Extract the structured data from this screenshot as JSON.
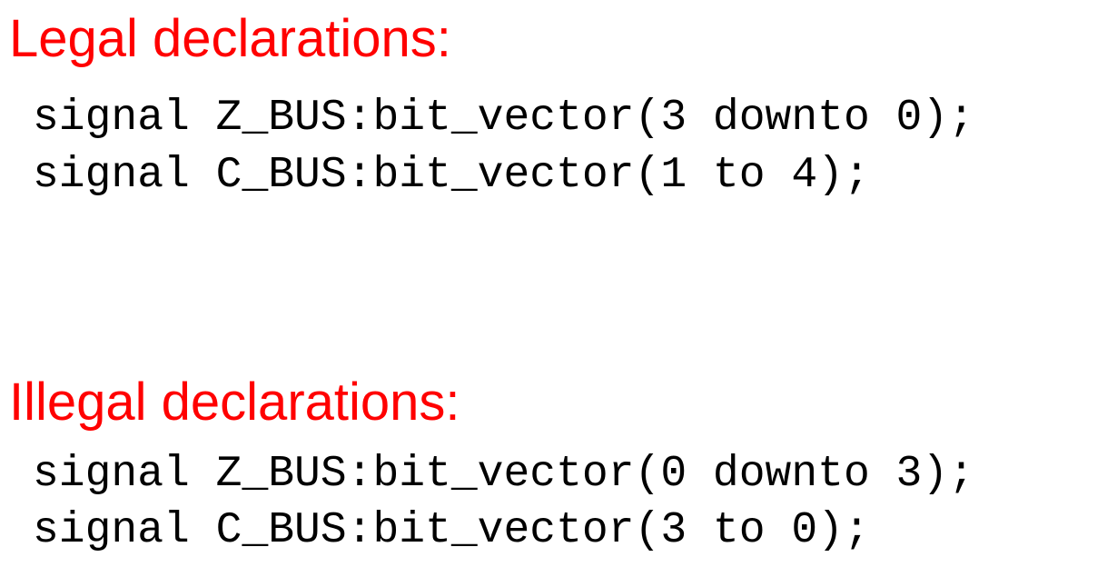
{
  "legal": {
    "heading": "Legal declarations:",
    "lines": [
      "signal Z_BUS:bit_vector(3 downto 0);",
      "signal C_BUS:bit_vector(1 to 4);"
    ]
  },
  "illegal": {
    "heading": "Illegal declarations:",
    "lines": [
      "signal Z_BUS:bit_vector(0 downto 3);",
      "signal C_BUS:bit_vector(3 to 0);"
    ]
  },
  "colors": {
    "heading": "#ff0000",
    "code": "#000000",
    "background": "#ffffff"
  }
}
